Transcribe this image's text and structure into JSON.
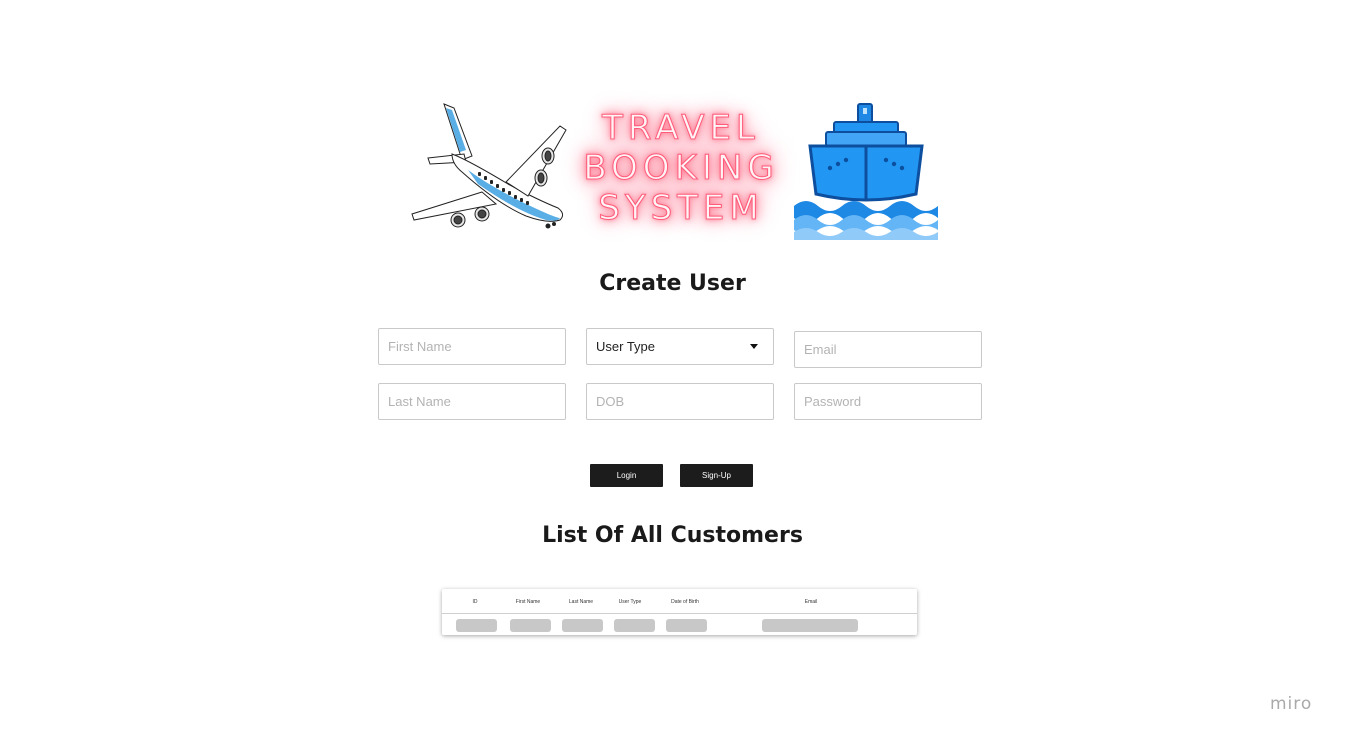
{
  "hero": {
    "title_lines": [
      "TRAVEL",
      "BOOKING",
      "SYSTEM"
    ],
    "plane_icon": "airplane-icon",
    "ship_icon": "ship-icon"
  },
  "create_user": {
    "title": "Create User",
    "first_name_placeholder": "First Name",
    "last_name_placeholder": "Last Name",
    "user_type_value": "User Type",
    "dob_placeholder": "DOB",
    "email_placeholder": "Email",
    "password_placeholder": "Password",
    "login_label": "Login",
    "signup_label": "Sign-Up"
  },
  "customers": {
    "title": "List Of All Customers",
    "columns": [
      "ID",
      "First Name",
      "Last Name",
      "User Type",
      "Date of Birth",
      "Email"
    ]
  },
  "brand": "miro",
  "colors": {
    "button_bg": "#1c1c1c",
    "neon": "#ff5b79",
    "plane_blue": "#5aaee6",
    "ship_blue": "#2196f3"
  }
}
